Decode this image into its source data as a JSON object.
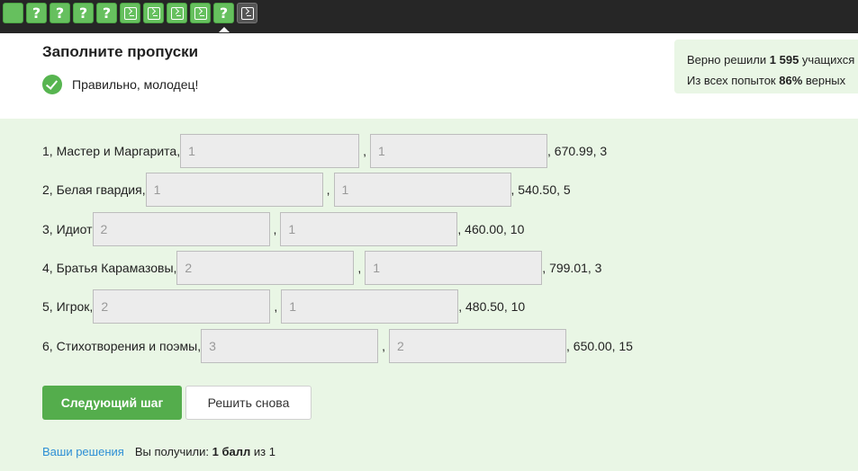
{
  "steps": [
    {
      "kind": "blank",
      "label": ""
    },
    {
      "kind": "question",
      "label": "?"
    },
    {
      "kind": "question",
      "label": "?"
    },
    {
      "kind": "question",
      "label": "?"
    },
    {
      "kind": "question",
      "label": "?"
    },
    {
      "kind": "terminal",
      "label": ""
    },
    {
      "kind": "terminal",
      "label": ""
    },
    {
      "kind": "terminal",
      "label": ""
    },
    {
      "kind": "terminal",
      "label": ""
    },
    {
      "kind": "question-active",
      "label": "?"
    },
    {
      "kind": "terminal-dark",
      "label": ""
    }
  ],
  "header": {
    "title": "Заполните пропуски",
    "success_text": "Правильно, молодец!"
  },
  "stats": {
    "line1_prefix": "Верно решили ",
    "solved_count": "1 595",
    "line1_suffix": " учащихся",
    "line2_prefix": "Из всех попыток ",
    "percent": "86%",
    "line2_suffix": " верных"
  },
  "rows": [
    {
      "prefix": "1, Мастер и Маргарита,",
      "input1": "1",
      "sep": ",",
      "input2": "1",
      "suffix": ", 670.99, 3"
    },
    {
      "prefix": "2, Белая гвардия,",
      "input1": "1",
      "sep": ",",
      "input2": "1",
      "suffix": ", 540.50, 5"
    },
    {
      "prefix": "3, Идиот",
      "input1": "2",
      "sep": ",",
      "input2": "1",
      "suffix": ", 460.00, 10"
    },
    {
      "prefix": "4, Братья Карамазовы,",
      "input1": "2",
      "sep": ",",
      "input2": "1",
      "suffix": ", 799.01, 3"
    },
    {
      "prefix": "5, Игрок,",
      "input1": "2",
      "sep": ",",
      "input2": "1",
      "suffix": ", 480.50, 10"
    },
    {
      "prefix": "6, Стихотворения и поэмы,",
      "input1": "3",
      "sep": ",",
      "input2": "2",
      "suffix": ", 650.00, 15"
    }
  ],
  "buttons": {
    "next": "Следующий шаг",
    "retry": "Решить снова"
  },
  "footer": {
    "solutions_link": "Ваши решения",
    "score_prefix": "Вы получили: ",
    "score_value": "1 балл",
    "score_suffix": " из 1"
  },
  "colors": {
    "accent_green": "#54ad4c",
    "page_bg": "#e9f6e5",
    "link_blue": "#2d8fd5",
    "topbar": "#262626"
  }
}
